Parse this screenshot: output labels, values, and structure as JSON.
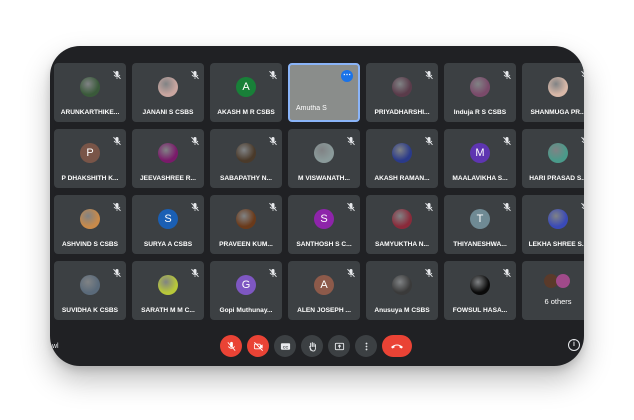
{
  "participants": [
    {
      "name": "ARUNKARTHIKE...",
      "avatar": "photo",
      "color": "#3a5a3a"
    },
    {
      "name": "JANANI S CSBS",
      "avatar": "photo",
      "color": "#c9a6a0"
    },
    {
      "name": "AKASH M R CSBS",
      "avatar": "A",
      "color": "#188038"
    },
    {
      "name": "Amutha S",
      "avatar": "video",
      "color": "#8a8d8b"
    },
    {
      "name": "PRIYADHARSHI...",
      "avatar": "photo",
      "color": "#5a3b4a"
    },
    {
      "name": "Indujа R S CSBS",
      "avatar": "photo",
      "color": "#7a4a6a"
    },
    {
      "name": "SHANMUGA PR...",
      "avatar": "photo",
      "color": "#d8b8a8"
    },
    {
      "name": "P DHAKSHITH K...",
      "avatar": "P",
      "color": "#795548"
    },
    {
      "name": "JEEVASHREE R...",
      "avatar": "photo",
      "color": "#7a1a6a"
    },
    {
      "name": "SABAPATHY N...",
      "avatar": "photo",
      "color": "#4a3a2a"
    },
    {
      "name": "M VISWANATH...",
      "avatar": "photo",
      "color": "#8a9a9a"
    },
    {
      "name": "AKASH RAMAN...",
      "avatar": "photo",
      "color": "#2a3a8a"
    },
    {
      "name": "MAALAVIKHA S...",
      "avatar": "M",
      "color": "#5e35b1"
    },
    {
      "name": "HARI PRASAD S...",
      "avatar": "photo",
      "color": "#4a9a8a"
    },
    {
      "name": "ASHVIND S CSBS",
      "avatar": "photo",
      "color": "#c88a4a"
    },
    {
      "name": "SURYA A CSBS",
      "avatar": "S",
      "color": "#1a5fb4"
    },
    {
      "name": "PRAVEEN KUM...",
      "avatar": "photo",
      "color": "#6a3a1a"
    },
    {
      "name": "SANTHOSH S C...",
      "avatar": "S",
      "color": "#8e24aa"
    },
    {
      "name": "SAMYUKTHA N...",
      "avatar": "photo",
      "color": "#8a2a3a"
    },
    {
      "name": "THIYANESHWA...",
      "avatar": "T",
      "color": "#6f8a94"
    },
    {
      "name": "LEKHA SHREE S...",
      "avatar": "photo",
      "color": "#3a4ab8"
    },
    {
      "name": "SUVIDHA K CSBS",
      "avatar": "photo",
      "color": "#5a6a7a"
    },
    {
      "name": "SARATH M M C...",
      "avatar": "photo",
      "color": "#b8c83a"
    },
    {
      "name": "Gopi Muthunay...",
      "avatar": "G",
      "color": "#7e57c2"
    },
    {
      "name": "ALEN JOSEPH ...",
      "avatar": "A",
      "color": "#8d5a4a"
    },
    {
      "name": "Anusuya M CSBS",
      "avatar": "photo",
      "color": "#3a3a3a"
    },
    {
      "name": "FOWSUL HASA...",
      "avatar": "photo",
      "color": "#0a0a0a"
    }
  ],
  "overflow": {
    "label": "6 others"
  },
  "footer": {
    "left_text": "wl",
    "info_icon": "i"
  },
  "controls": [
    {
      "name": "mic-off-button",
      "icon": "mic-off-icon",
      "style": "red"
    },
    {
      "name": "camera-off-button",
      "icon": "camera-off-icon",
      "style": "red"
    },
    {
      "name": "captions-button",
      "icon": "captions-icon",
      "style": "dark",
      "label": "CC"
    },
    {
      "name": "raise-hand-button",
      "icon": "hand-icon",
      "style": "dark"
    },
    {
      "name": "present-button",
      "icon": "present-icon",
      "style": "dark"
    },
    {
      "name": "more-options-button",
      "icon": "more-vert-icon",
      "style": "dark"
    },
    {
      "name": "end-call-button",
      "icon": "phone-hangup-icon",
      "style": "end"
    }
  ],
  "colors": {
    "background": "#202124",
    "tile": "#3c4043",
    "accent": "#8ab4f8",
    "danger": "#ea4335"
  }
}
